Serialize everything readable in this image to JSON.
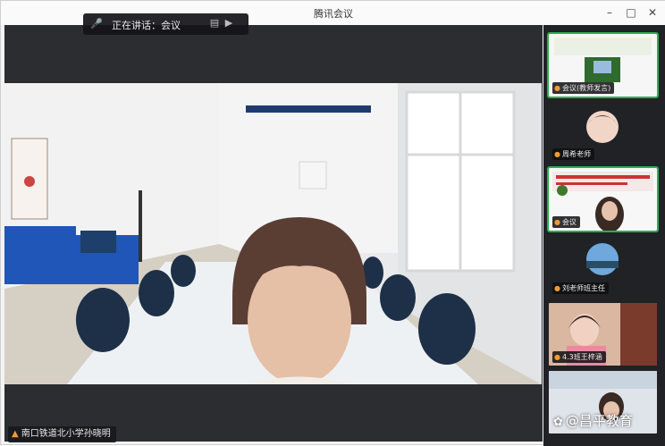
{
  "app": {
    "title": "腾讯会议"
  },
  "window_controls": {
    "minimize": "–",
    "maximize": "□",
    "close": "✕"
  },
  "speaking": {
    "label": "正在讲话：会议"
  },
  "main_video": {
    "name": "南口铁道北小学孙晓明"
  },
  "participants": [
    {
      "name": "会议(教师发言)"
    },
    {
      "name": "周希老师"
    },
    {
      "name": "会议"
    },
    {
      "name": "刘老师班主任"
    },
    {
      "name": "4.3班王梓涵"
    },
    {
      "name": ""
    }
  ],
  "watermark": {
    "text": "@昌平教育"
  },
  "colors": {
    "active_border": "#2fae4f",
    "mic_orange": "#f09a32",
    "stage_bg": "#2b2d31"
  }
}
